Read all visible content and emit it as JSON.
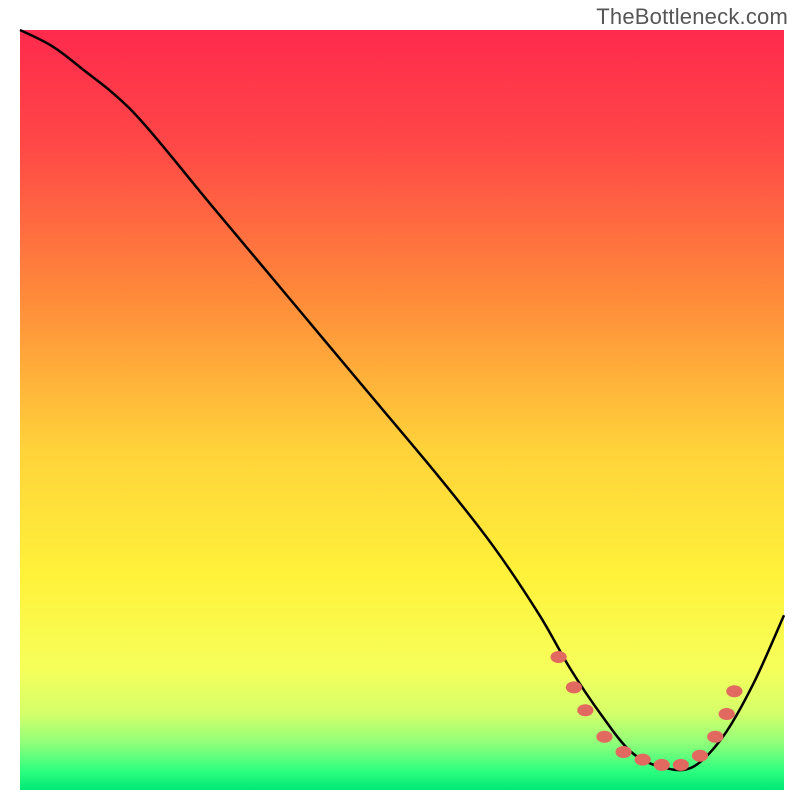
{
  "attribution": "TheBottleneck.com",
  "chart_data": {
    "type": "line",
    "title": "",
    "xlabel": "",
    "ylabel": "",
    "xlim": [
      0,
      100
    ],
    "ylim": [
      0,
      100
    ],
    "background_gradient": {
      "stops": [
        {
          "offset": 0.0,
          "color": "#ff2a4d"
        },
        {
          "offset": 0.15,
          "color": "#ff4747"
        },
        {
          "offset": 0.35,
          "color": "#ff8a3a"
        },
        {
          "offset": 0.55,
          "color": "#ffd23a"
        },
        {
          "offset": 0.72,
          "color": "#fff23a"
        },
        {
          "offset": 0.84,
          "color": "#f6ff5a"
        },
        {
          "offset": 0.9,
          "color": "#d4ff6a"
        },
        {
          "offset": 0.94,
          "color": "#8cff7a"
        },
        {
          "offset": 0.975,
          "color": "#2dff7f"
        },
        {
          "offset": 1.0,
          "color": "#00e876"
        }
      ]
    },
    "series": [
      {
        "name": "bottleneck-curve",
        "color": "#000000",
        "stroke_width": 2.5,
        "x": [
          0,
          4,
          8,
          15,
          25,
          35,
          45,
          55,
          62,
          68,
          72,
          76,
          80,
          84,
          88,
          92,
          96,
          100
        ],
        "y": [
          100,
          98,
          95,
          89,
          77,
          65,
          53,
          41,
          32,
          23,
          16,
          10,
          5,
          3,
          3,
          7,
          14,
          23
        ]
      }
    ],
    "markers": {
      "name": "optimal-zone-dots",
      "color": "#e2695f",
      "radius": 6,
      "points": [
        {
          "x": 70.5,
          "y": 17.5
        },
        {
          "x": 72.5,
          "y": 13.5
        },
        {
          "x": 74.0,
          "y": 10.5
        },
        {
          "x": 76.5,
          "y": 7.0
        },
        {
          "x": 79.0,
          "y": 5.0
        },
        {
          "x": 81.5,
          "y": 4.0
        },
        {
          "x": 84.0,
          "y": 3.3
        },
        {
          "x": 86.5,
          "y": 3.3
        },
        {
          "x": 89.0,
          "y": 4.5
        },
        {
          "x": 91.0,
          "y": 7.0
        },
        {
          "x": 92.5,
          "y": 10.0
        },
        {
          "x": 93.5,
          "y": 13.0
        }
      ]
    }
  }
}
